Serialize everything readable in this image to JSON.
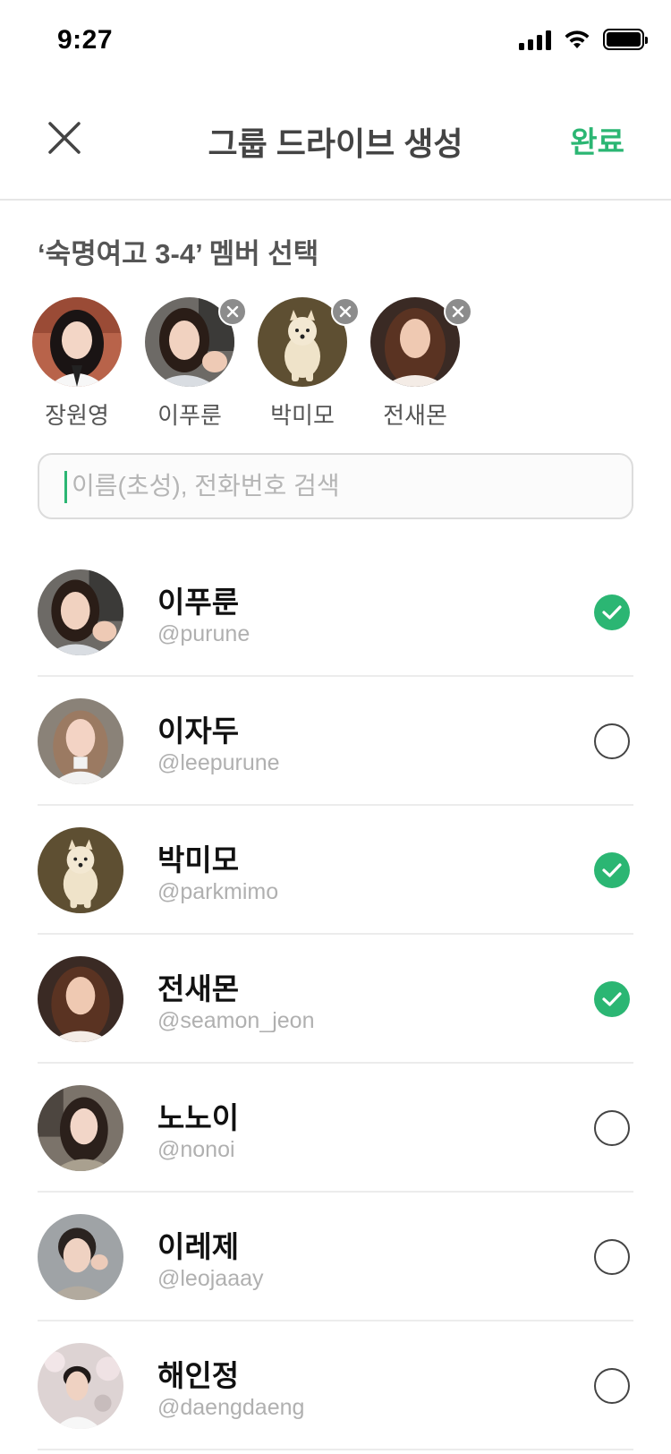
{
  "status_bar": {
    "time": "9:27"
  },
  "header": {
    "title": "그룹 드라이브 생성",
    "done_label": "완료"
  },
  "section_title": "‘숙명여고 3-4’ 멤버 선택",
  "selected_members": [
    {
      "name": "장원영",
      "avatar": "girl-dark-hair",
      "removable": false
    },
    {
      "name": "이푸룬",
      "avatar": "girl-car",
      "removable": true
    },
    {
      "name": "박미모",
      "avatar": "pomeranian-dog",
      "removable": true
    },
    {
      "name": "전새몬",
      "avatar": "girl-brown-hair",
      "removable": true
    }
  ],
  "search": {
    "placeholder": "이름(초성), 전화번호 검색",
    "value": ""
  },
  "members": [
    {
      "name": "이푸룬",
      "handle": "@purune",
      "checked": true,
      "avatar": "girl-car"
    },
    {
      "name": "이자두",
      "handle": "@leepurune",
      "checked": false,
      "avatar": "girl-white-top"
    },
    {
      "name": "박미모",
      "handle": "@parkmimo",
      "checked": true,
      "avatar": "pomeranian-dog"
    },
    {
      "name": "전새몬",
      "handle": "@seamon_jeon",
      "checked": true,
      "avatar": "girl-brown-hair"
    },
    {
      "name": "노노이",
      "handle": "@nonoi",
      "checked": false,
      "avatar": "girl-cafe"
    },
    {
      "name": "이레제",
      "handle": "@leojaaay",
      "checked": false,
      "avatar": "boy-sweater"
    },
    {
      "name": "해인정",
      "handle": "@daengdaeng",
      "checked": false,
      "avatar": "boy-cherry-blossom"
    }
  ],
  "colors": {
    "accent": "#2bb673",
    "title_text": "#444444",
    "handle_text": "#b0b0b0"
  }
}
